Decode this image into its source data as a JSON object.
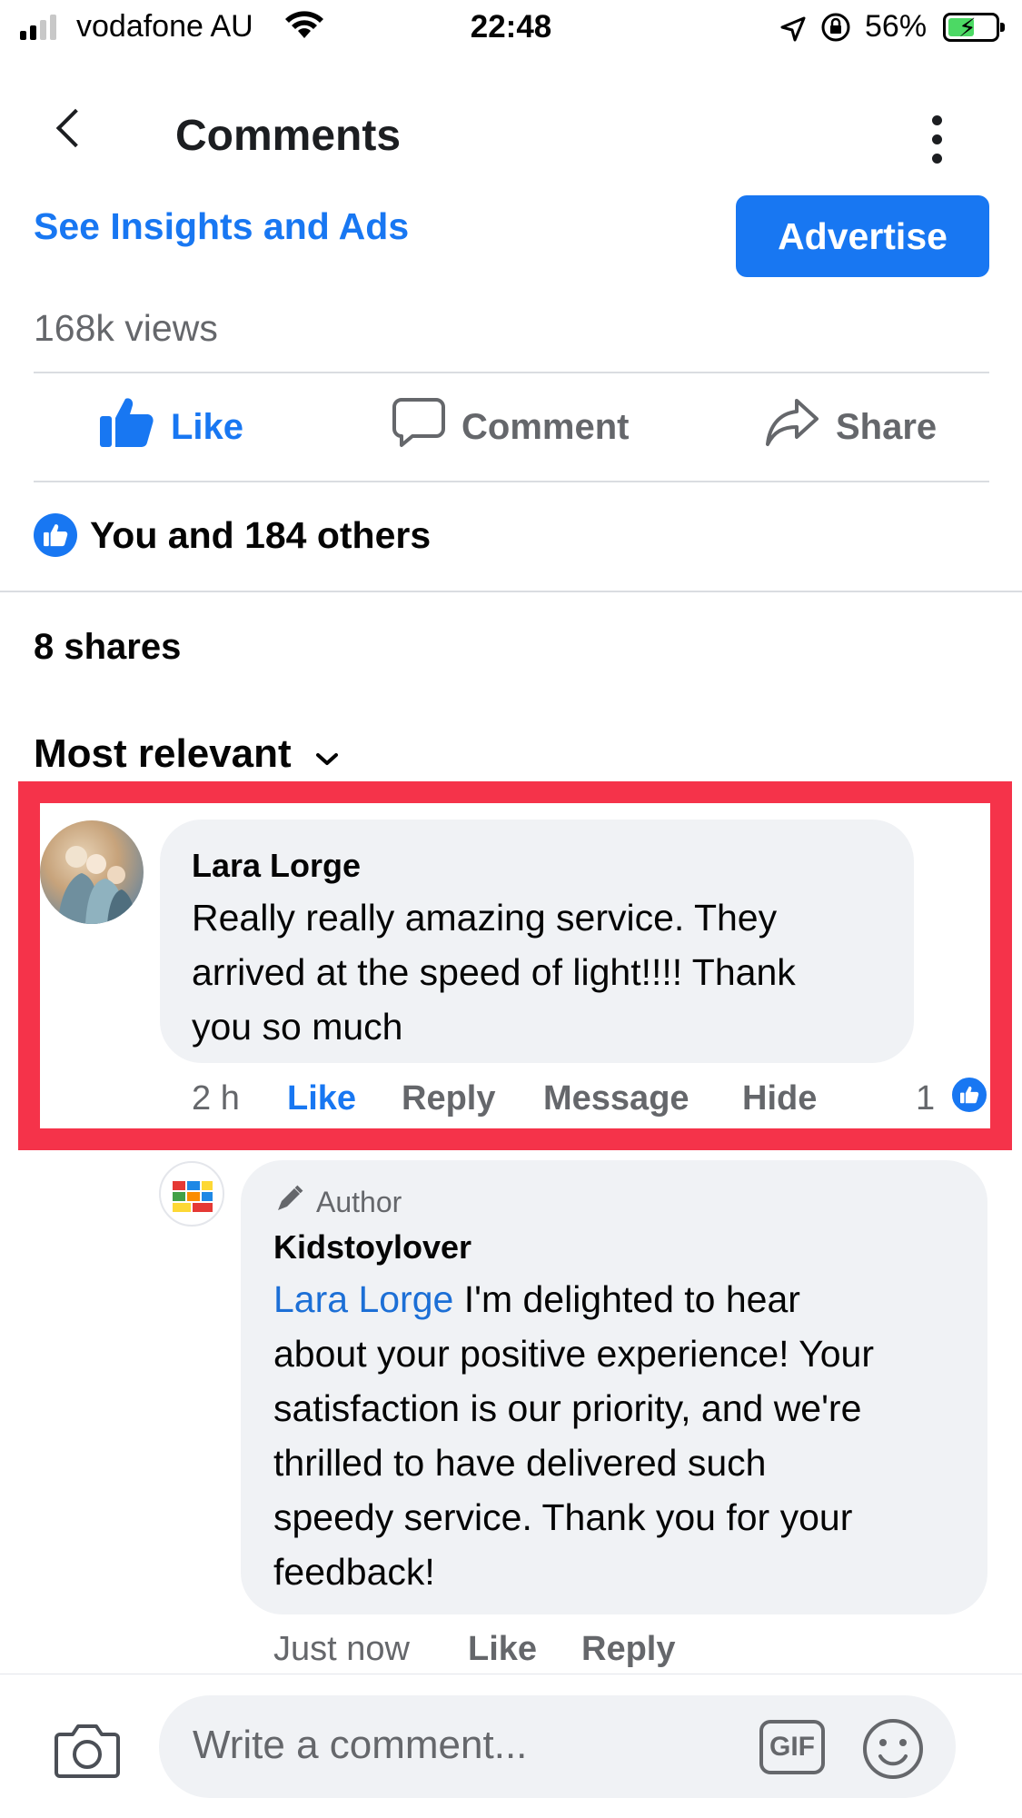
{
  "status_bar": {
    "carrier": "vodafone AU",
    "time": "22:48",
    "battery": "56%",
    "battery_level": 0.56
  },
  "header": {
    "title": "Comments",
    "insights_link": "See Insights and Ads",
    "advertise_button": "Advertise"
  },
  "post_stats": {
    "views": "168k views",
    "reactions": "You and 184 others",
    "shares": "8 shares"
  },
  "actions": {
    "like": "Like",
    "comment": "Comment",
    "share": "Share"
  },
  "sort": {
    "label": "Most relevant"
  },
  "comments": [
    {
      "author": "Lara Lorge",
      "lines": [
        "Really really amazing service. They",
        "arrived at the speed of light!!!! Thank",
        "you so much"
      ],
      "time": "2 h",
      "like": "Like",
      "reply": "Reply",
      "message": "Message",
      "hide": "Hide",
      "reaction_count": "1"
    }
  ],
  "reply": {
    "badge": "Author",
    "author": "Kidstoylover",
    "mention": "Lara Lorge",
    "lines": [
      " I'm delighted to hear",
      "about your positive experience! Your",
      "satisfaction is our priority, and we're",
      "thrilled to have delivered such",
      "speedy service. Thank you for your",
      "feedback!"
    ],
    "time": "Just now",
    "like": "Like",
    "reply": "Reply"
  },
  "composer": {
    "placeholder": "Write a comment...",
    "gif": "GIF"
  },
  "colors": {
    "accent": "#1877f2",
    "highlight": "#f5334a",
    "bubble": "#f0f2f5"
  },
  "icons": [
    "signal-icon",
    "wifi-icon",
    "location-icon",
    "orientation-lock-icon",
    "battery-icon",
    "back-icon",
    "more-icon",
    "thumbs-up-icon",
    "comment-icon",
    "share-icon",
    "chevron-down-icon",
    "pencil-icon",
    "camera-icon",
    "gif-icon",
    "emoji-icon"
  ]
}
